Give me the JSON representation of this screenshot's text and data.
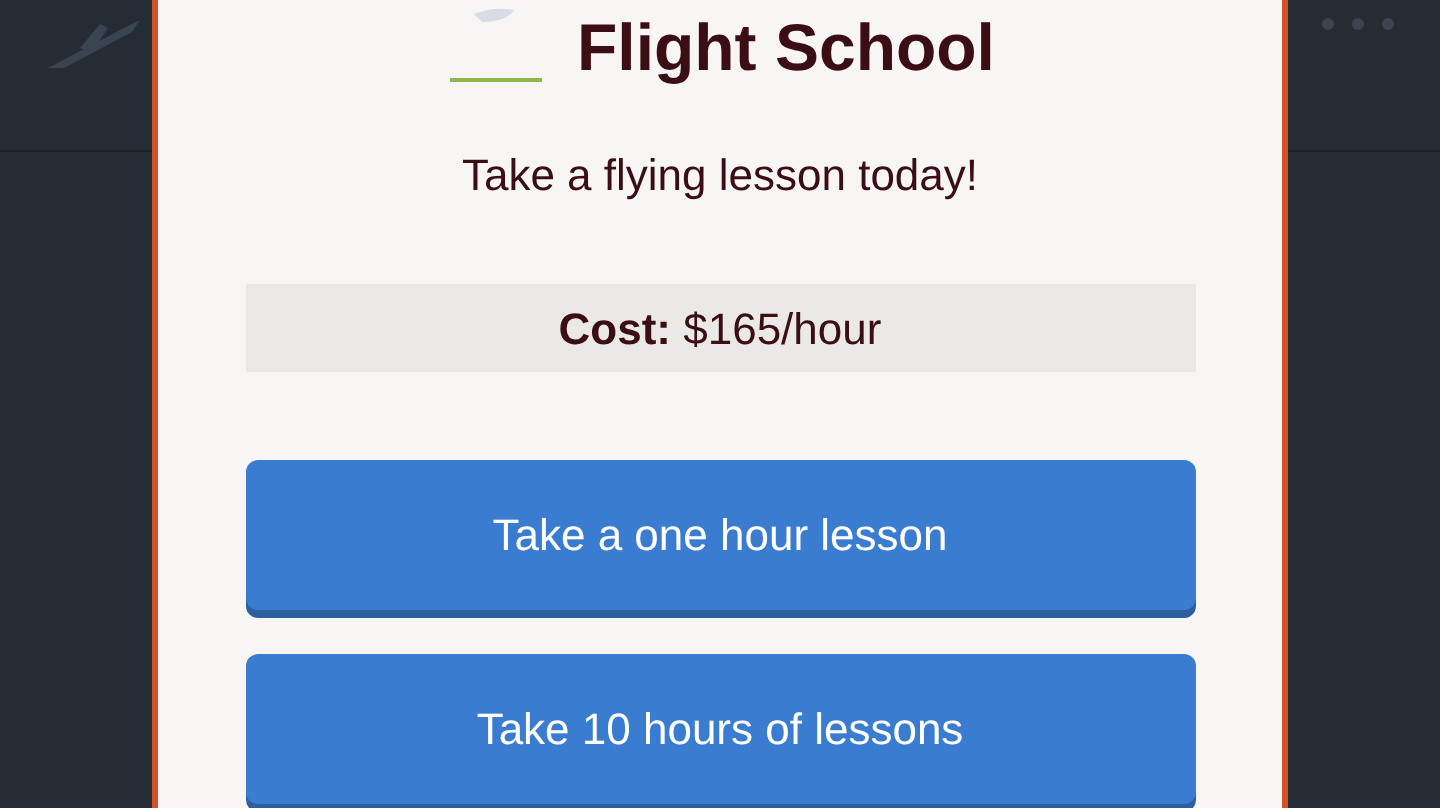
{
  "dialog": {
    "title": "Flight School",
    "subtitle": "Take a flying lesson today!",
    "cost": "**Cost:** $165/hour"
  },
  "buttons": [
    {
      "label": "Take a one hour lesson"
    },
    {
      "label": "Take 10 hours of lessons"
    }
  ]
}
